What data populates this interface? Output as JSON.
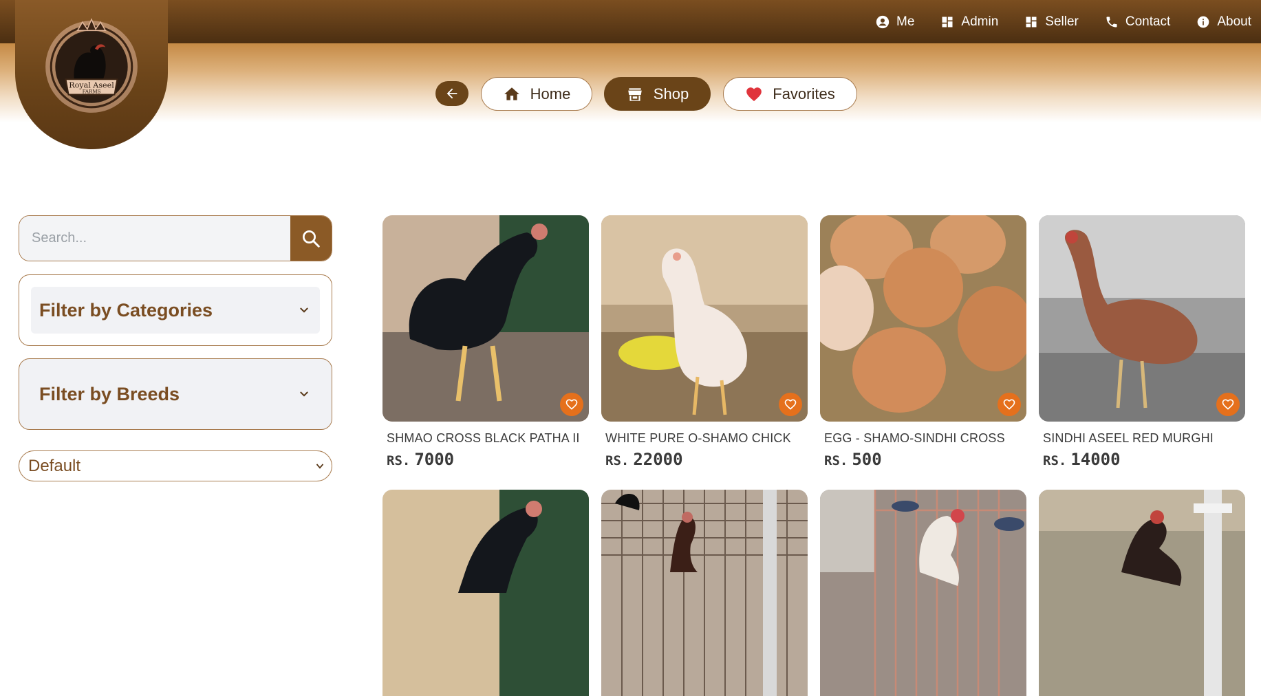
{
  "brand": {
    "logo_line1": "Royal Aseel",
    "logo_line2": "FARMS"
  },
  "topnav": [
    {
      "label": "Me",
      "icon": "user-circle-icon"
    },
    {
      "label": "Admin",
      "icon": "dashboard-icon"
    },
    {
      "label": "Seller",
      "icon": "dashboard-icon"
    },
    {
      "label": "Contact",
      "icon": "phone-icon"
    },
    {
      "label": "About",
      "icon": "info-icon"
    }
  ],
  "nav": {
    "back_icon": "arrow-left-icon",
    "home": "Home",
    "shop": "Shop",
    "favorites": "Favorites",
    "active": "Shop"
  },
  "sidebar": {
    "search_placeholder": "Search...",
    "filter_categories": "Filter by Categories",
    "filter_breeds": "Filter by Breeds",
    "sort_selected": "Default"
  },
  "colors": {
    "brand_brown": "#6a4418",
    "accent_orange": "#e5701c",
    "heart_red": "#e0343c"
  },
  "products": [
    {
      "name": "SHMAO CROSS BLACK PATHA II",
      "currency": "RS.",
      "price": "7000"
    },
    {
      "name": "WHITE PURE O-SHAMO CHICK",
      "currency": "RS.",
      "price": "22000"
    },
    {
      "name": "EGG - SHAMO-SINDHI CROSS",
      "currency": "RS.",
      "price": "500"
    },
    {
      "name": "SINDHI ASEEL RED MURGHI",
      "currency": "RS.",
      "price": "14000"
    }
  ]
}
